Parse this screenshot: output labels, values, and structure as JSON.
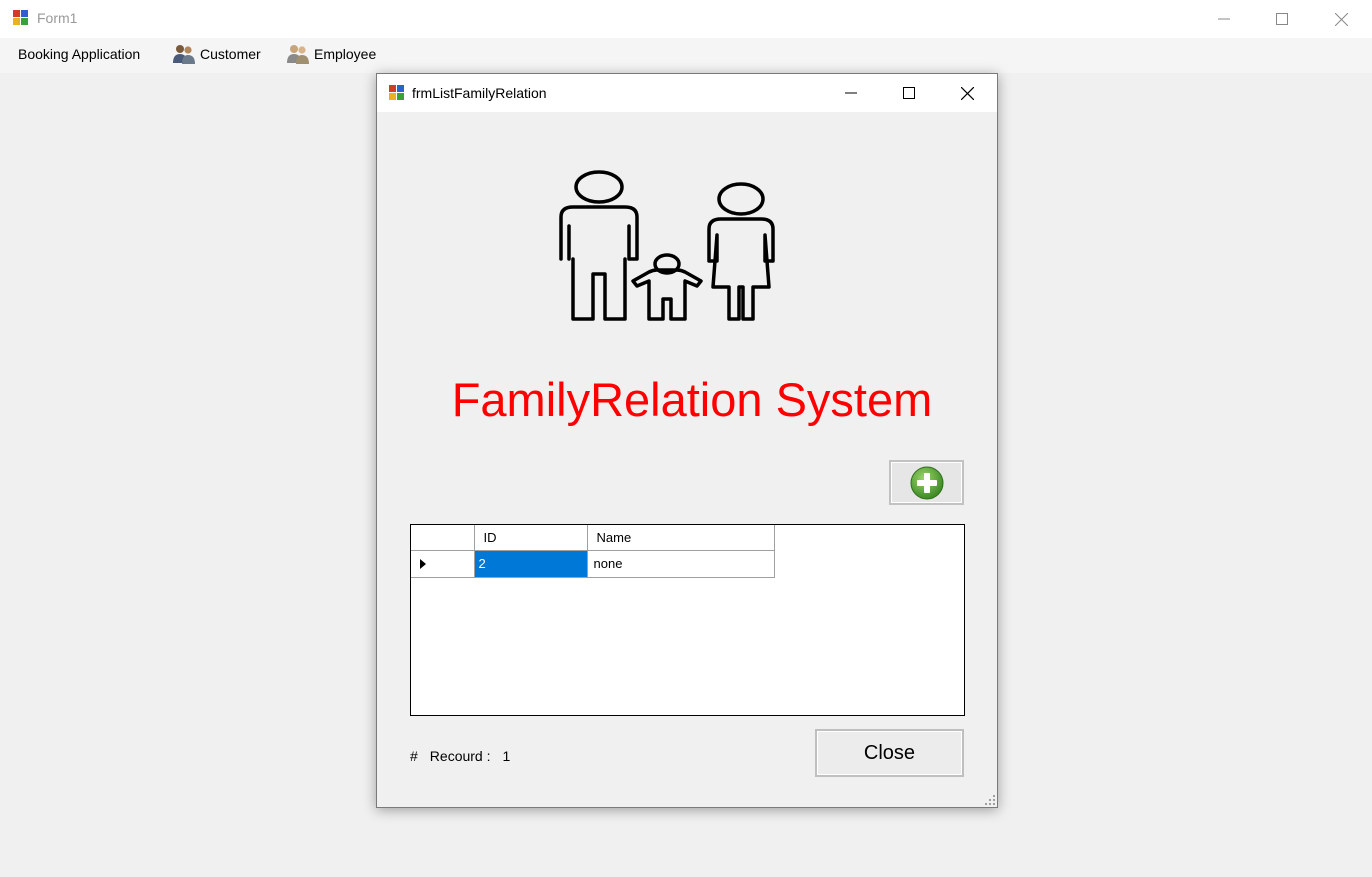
{
  "main_window": {
    "title": "Form1",
    "menu": [
      {
        "label": "Booking Application",
        "icon": null
      },
      {
        "label": "Customer",
        "icon": "people-icon"
      },
      {
        "label": "Employee",
        "icon": "people-icon"
      }
    ]
  },
  "child_window": {
    "title": "frmListFamilyRelation",
    "heading": "FamilyRelation System",
    "image_icon": "family-icon",
    "add_button_icon": "plus-circle-icon",
    "grid": {
      "columns": [
        "ID",
        "Name"
      ],
      "rows": [
        {
          "id": "2",
          "name": "none"
        }
      ]
    },
    "record": {
      "hash": "#",
      "label": "Recourd :",
      "count": "1"
    },
    "close_label": "Close"
  },
  "colors": {
    "heading": "#ff0000",
    "selection": "#0078d7",
    "add_icon": "#5aa83a"
  }
}
